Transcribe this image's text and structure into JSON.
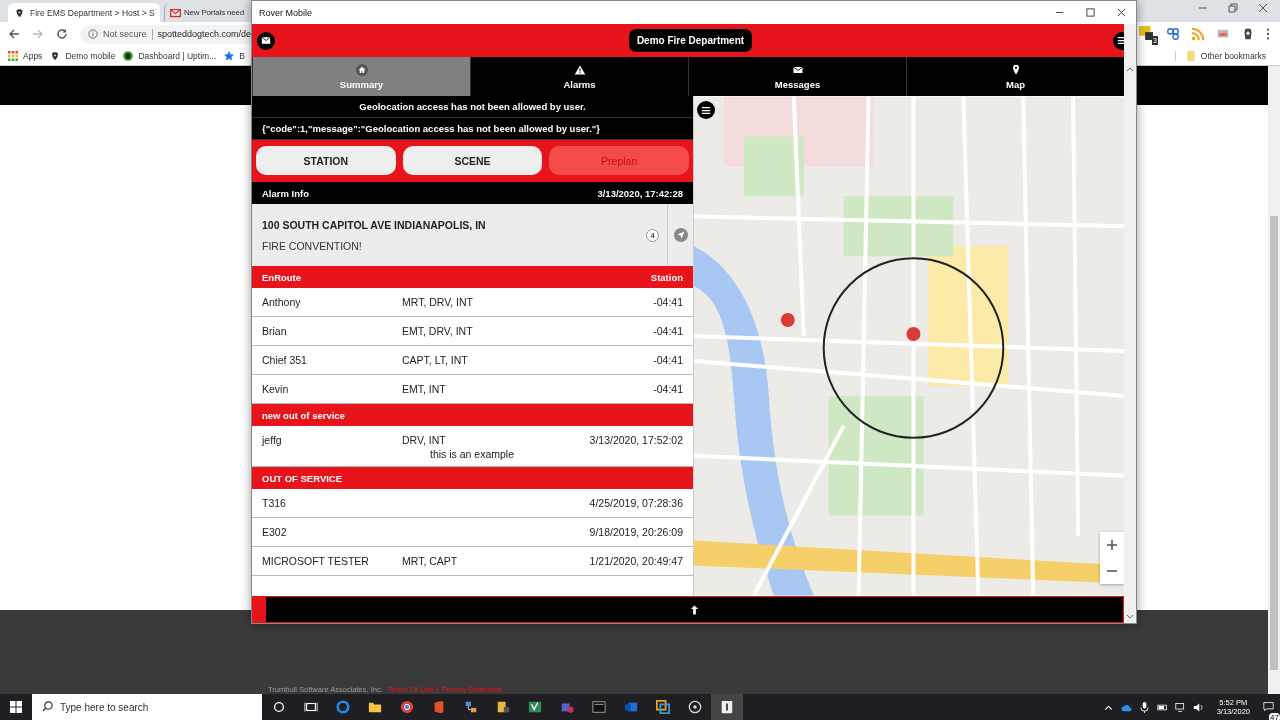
{
  "browser": {
    "tabs": [
      {
        "title": "Fire EMS Department > Host > S",
        "selected": true
      },
      {
        "title": "New Portals need",
        "selected": false
      }
    ],
    "security": "Not secure",
    "url": "spotteddogtech.com/de",
    "bookmarks": [
      "Apps",
      "Demo mobile",
      "Dashboard | Uptim...",
      "B"
    ],
    "extension_badge": "3",
    "other_bookmarks": "Other bookmarks",
    "footer": {
      "company": "Trumbull Software Associates, Inc.",
      "links": [
        "Terms Of Use",
        "Privacy Statement"
      ],
      "separator": "|"
    }
  },
  "app_window": {
    "title": "Rover Mobile",
    "department": "Demo Fire Department",
    "tabs": [
      {
        "label": "Summary",
        "selected": true
      },
      {
        "label": "Alarms",
        "selected": false
      },
      {
        "label": "Messages",
        "selected": false
      },
      {
        "label": "Map",
        "selected": false
      }
    ],
    "notices": [
      "Geolocation access has not been allowed by user.",
      "{\"code\":1,\"message\":\"Geolocation access has not been allowed by user.\"}"
    ],
    "destinations": [
      {
        "label": "STATION",
        "disabled": false
      },
      {
        "label": "SCENE",
        "disabled": false
      },
      {
        "label": "Preplan",
        "disabled": true
      }
    ],
    "alarm": {
      "heading": "Alarm Info",
      "time": "3/13/2020, 17:42:28",
      "address": "100 SOUTH CAPITOL AVE INDIANAPOLIS, IN",
      "description": "FIRE CONVENTION!",
      "count": "4"
    },
    "sections": [
      {
        "title": "EnRoute",
        "column": "Station",
        "rows": [
          {
            "name": "Anthony",
            "roles": "MRT, DRV, INT",
            "time": "-04:41"
          },
          {
            "name": "Brian",
            "roles": "EMT, DRV, INT",
            "time": "-04:41"
          },
          {
            "name": "Chief 351",
            "roles": "CAPT, LT, INT",
            "time": "-04:41"
          },
          {
            "name": "Kevin",
            "roles": "EMT, INT",
            "time": "-04:41"
          }
        ]
      },
      {
        "title": "new out of service",
        "rows": [
          {
            "name": "jeffg",
            "roles": "DRV, INT",
            "time": "3/13/2020, 17:52:02",
            "note": "this is an example"
          }
        ]
      },
      {
        "title": "OUT OF SERVICE",
        "rows": [
          {
            "name": "T316",
            "time": "4/25/2019, 07:28:36"
          },
          {
            "name": "E302",
            "time": "9/18/2019, 20:26:09"
          },
          {
            "name": "MICROSOFT TESTER",
            "roles": "MRT, CAPT",
            "time": "1/21/2020, 20:49:47"
          }
        ]
      }
    ]
  },
  "taskbar": {
    "search_placeholder": "Type here to search",
    "time": "5:52 PM",
    "date": "3/13/2020",
    "notifications": "47"
  }
}
